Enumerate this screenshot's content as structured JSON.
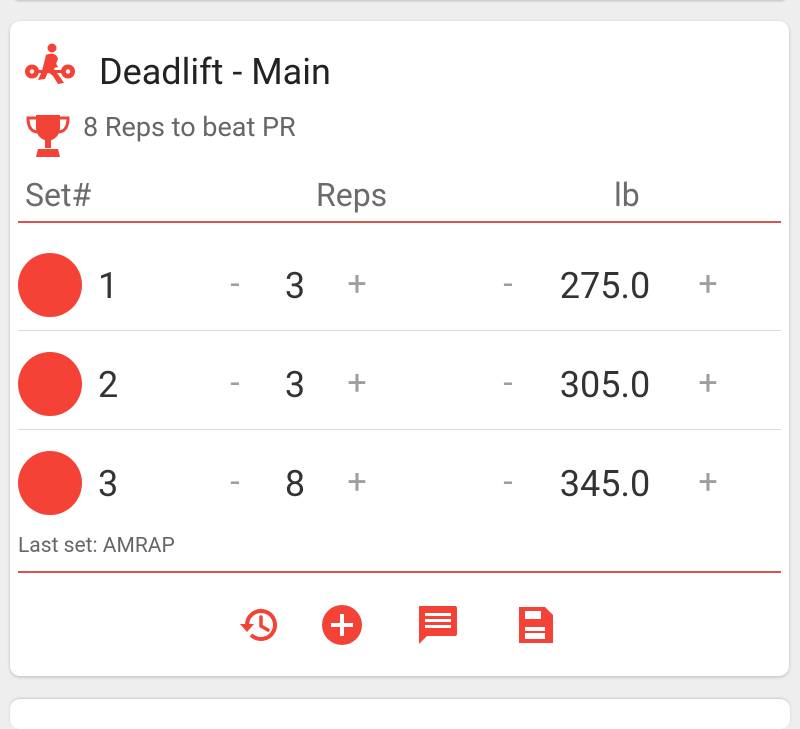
{
  "exercise": {
    "title": "Deadlift - Main",
    "icon": "deadlift-icon",
    "pr_text": "8 Reps to beat PR",
    "pr_icon": "trophy-icon"
  },
  "table": {
    "headers": {
      "set": "Set#",
      "reps": "Reps",
      "unit": "lb"
    },
    "minus": "-",
    "plus": "+",
    "rows": [
      {
        "set": "1",
        "reps": "3",
        "weight": "275.0"
      },
      {
        "set": "2",
        "reps": "3",
        "weight": "305.0"
      },
      {
        "set": "3",
        "reps": "8",
        "weight": "345.0"
      }
    ]
  },
  "footer_note": "Last set: AMRAP",
  "actions": [
    {
      "icon": "history-icon"
    },
    {
      "icon": "add-circle-icon"
    },
    {
      "icon": "comment-icon"
    },
    {
      "icon": "save-icon"
    }
  ],
  "colors": {
    "accent": "#f44336",
    "rule": "#d9534f"
  }
}
